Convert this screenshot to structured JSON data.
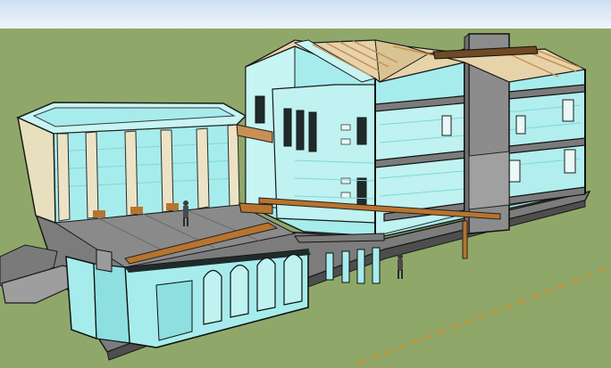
{
  "scene": {
    "kind": "3d-architectural-model",
    "colors": {
      "sky_top": "#cfe0f2",
      "sky_bottom": "#eef4fb",
      "ground": "#8fa86a",
      "wall_cyan": "#a7ecec",
      "wall_cyan_light": "#c6f5f3",
      "wall_cyan_dark": "#7fd7d8",
      "slab_gray": "#9b9b9b",
      "slab_dark": "#6f6f6f",
      "roof_beige": "#e6d3a9",
      "timber": "#c98f55",
      "beam_orange": "#b8742e",
      "column_cream": "#ece3c6",
      "axis_orange": "#e28a1a"
    },
    "elements": {
      "sky": "sky",
      "ground": "ground-plane",
      "left_annex": "open-colonnade-annex",
      "main_building": "three-storey-sectioned-building",
      "roof": "gable-roof-with-exposed-rafters",
      "stair_core": "stair-tower",
      "arcade": "front-arched-wall",
      "figures": [
        "scale-figure-courtyard",
        "scale-figure-ground-floor"
      ],
      "axis": "red-green-axis-guide"
    }
  }
}
